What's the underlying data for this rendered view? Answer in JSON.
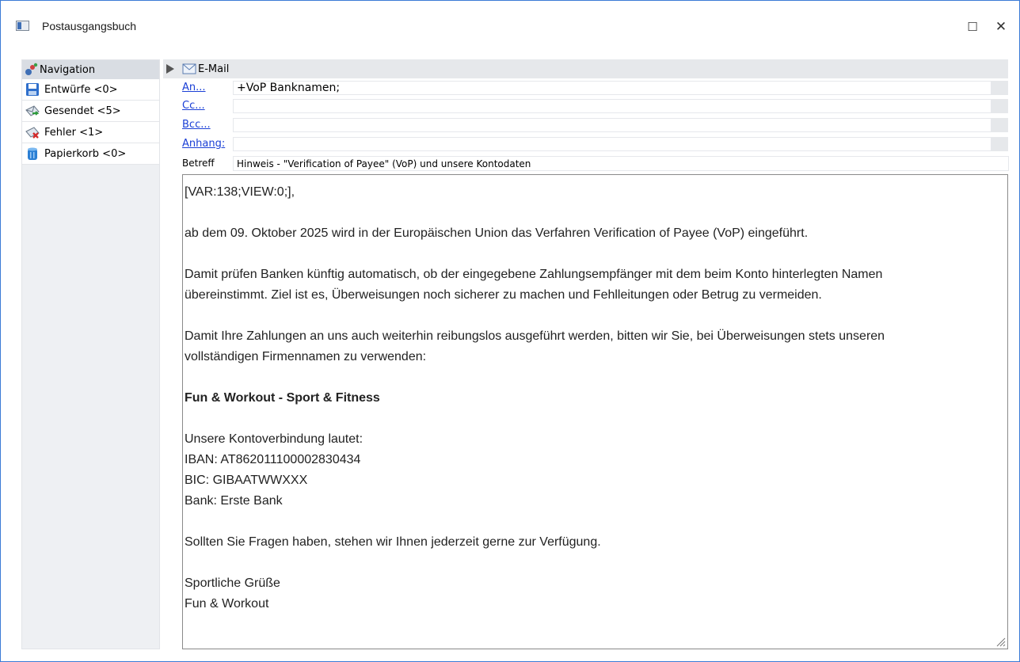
{
  "window": {
    "title": "Postausgangsbuch",
    "maximize_glyph": "☐",
    "close_glyph": "✕"
  },
  "navigation": {
    "header": "Navigation",
    "items": [
      {
        "label": "Entwürfe <0>",
        "icon": "floppy-disk-icon"
      },
      {
        "label": "Gesendet <5>",
        "icon": "sent-mail-icon"
      },
      {
        "label": "Fehler <1>",
        "icon": "error-mail-icon"
      },
      {
        "label": "Papierkorb <0>",
        "icon": "trash-bin-icon"
      }
    ]
  },
  "email": {
    "header": "E-Mail",
    "to_label": "An...",
    "to_value": "+VoP Banknamen;",
    "cc_label": "Cc...",
    "cc_value": "",
    "bcc_label": "Bcc...",
    "bcc_value": "",
    "attachment_label": "Anhang:",
    "attachment_value": "",
    "subject_label": "Betreff",
    "subject_value": "Hinweis - \"Verification of Payee\" (VoP) und unsere Kontodaten",
    "body": {
      "line1": "[VAR:138;VIEW:0;],",
      "line2": "ab dem 09. Oktober 2025 wird in der Europäischen Union das Verfahren Verification of Payee (VoP) eingeführt.",
      "line3": "Damit prüfen Banken künftig automatisch, ob der eingegebene Zahlungsempfänger mit dem beim Konto hinterlegten Namen",
      "line4": "übereinstimmt. Ziel ist es, Überweisungen noch sicherer zu machen und Fehlleitungen oder Betrug zu vermeiden.",
      "line5": "Damit Ihre Zahlungen an uns auch weiterhin reibungslos ausgeführt werden, bitten wir Sie, bei Überweisungen stets unseren",
      "line6": "vollständigen Firmennamen zu verwenden:",
      "company": "Fun & Workout - Sport & Fitness",
      "line7": "Unsere Kontoverbindung lautet:",
      "iban": "IBAN: AT862011100002830434",
      "bic": "BIC: GIBAATWWXXX",
      "bank": "Bank: Erste Bank",
      "line8": "Sollten Sie Fragen haben, stehen wir Ihnen jederzeit gerne zur Verfügung.",
      "closing1": "Sportliche Grüße",
      "closing2": "Fun & Workout"
    }
  },
  "colors": {
    "window_border": "#3b7bd6",
    "link": "#1a3fd6",
    "nav_header_bg": "#d9dde3"
  }
}
